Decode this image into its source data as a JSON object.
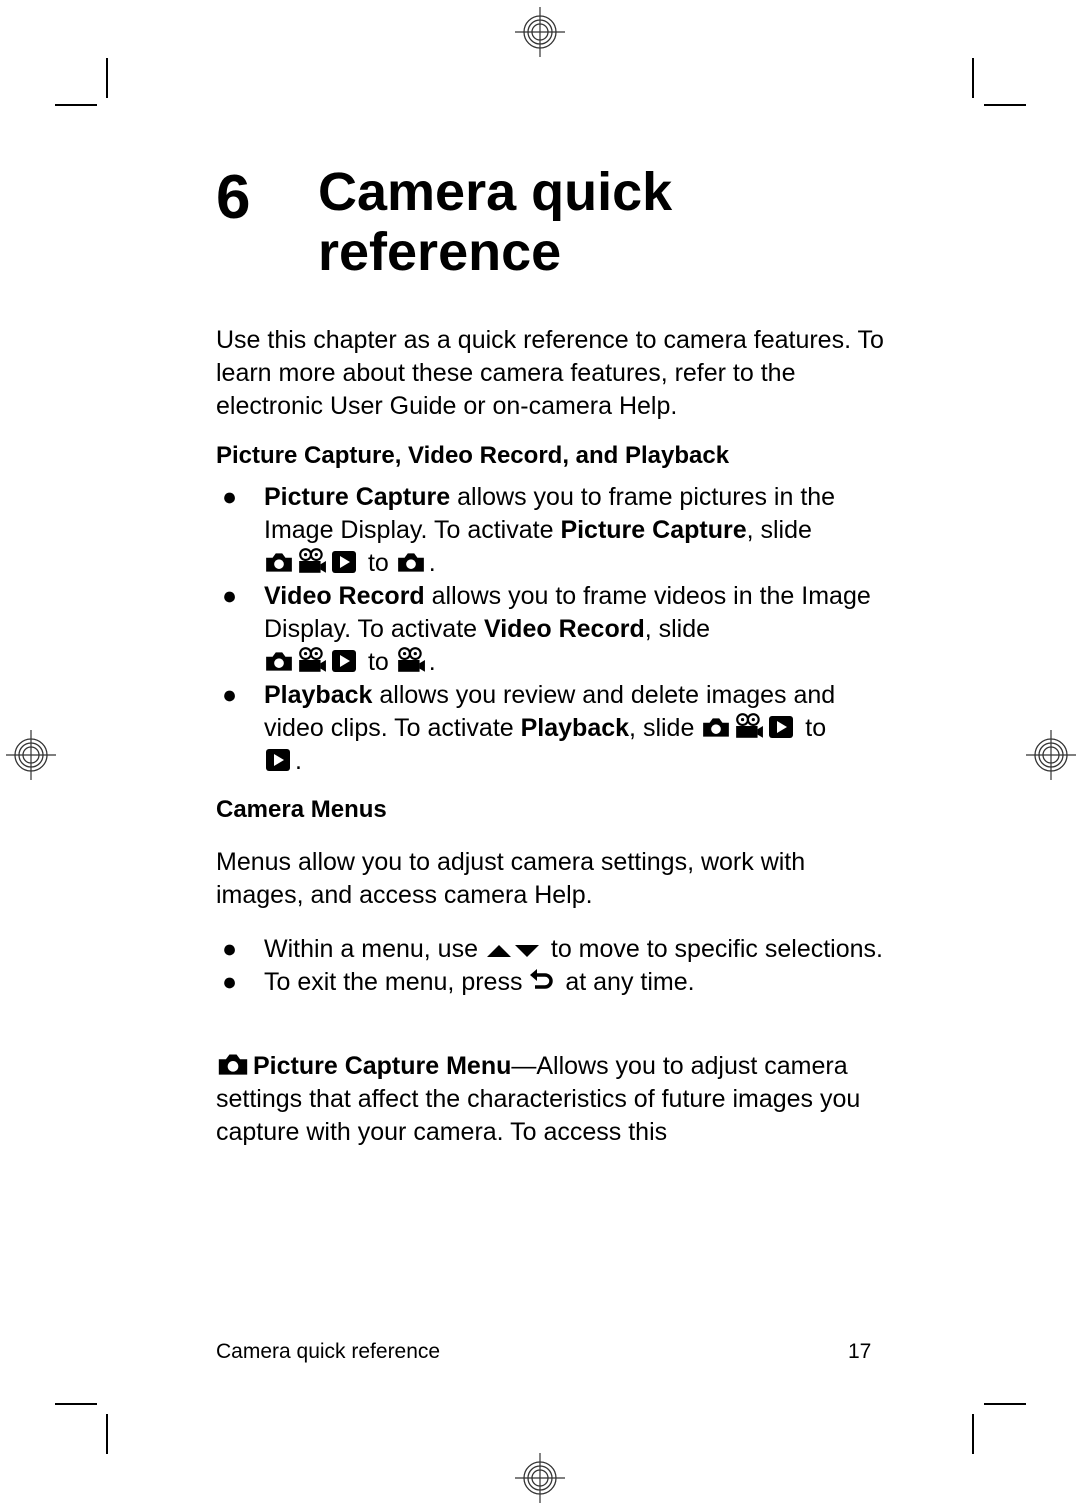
{
  "chapter": {
    "number": "6",
    "title_line1": "Camera quick",
    "title_line2": "reference"
  },
  "intro": "Use this chapter as a quick reference to camera features. To learn more about these camera features, refer to the electronic User Guide or on-camera Help.",
  "section1": {
    "heading": "Picture Capture, Video Record, and Playback",
    "items": [
      {
        "bold": "Picture Capture",
        "text1": " allows you to frame pictures in the Image Display. To activate ",
        "bold2": "Picture Capture",
        "text2": ", slide ",
        "to": " to ",
        "end": "."
      },
      {
        "bold": "Video Record",
        "text1": " allows you to frame videos in the Image Display. To activate ",
        "bold2": "Video Record",
        "text2": ", slide ",
        "to": " to ",
        "end": "."
      },
      {
        "bold": "Playback",
        "text1": " allows you review and delete images and video clips. To activate ",
        "bold2": "Playback",
        "text2": ", slide ",
        "to": " to ",
        "end": "."
      }
    ]
  },
  "section2": {
    "heading": "Camera Menus",
    "intro": "Menus allow you to adjust camera settings, work with images, and access camera Help.",
    "items": [
      {
        "text1": "Within a menu, use ",
        "text2": " to move to specific selections."
      },
      {
        "text1": "To exit the menu, press ",
        "text2": " at any time."
      }
    ],
    "menu_title": "Picture Capture Menu",
    "menu_text": "—Allows you to adjust camera settings that affect the characteristics of future images you capture with your camera. To access this"
  },
  "footer": {
    "title": "Camera quick reference",
    "page": "17"
  },
  "bullet": "●"
}
